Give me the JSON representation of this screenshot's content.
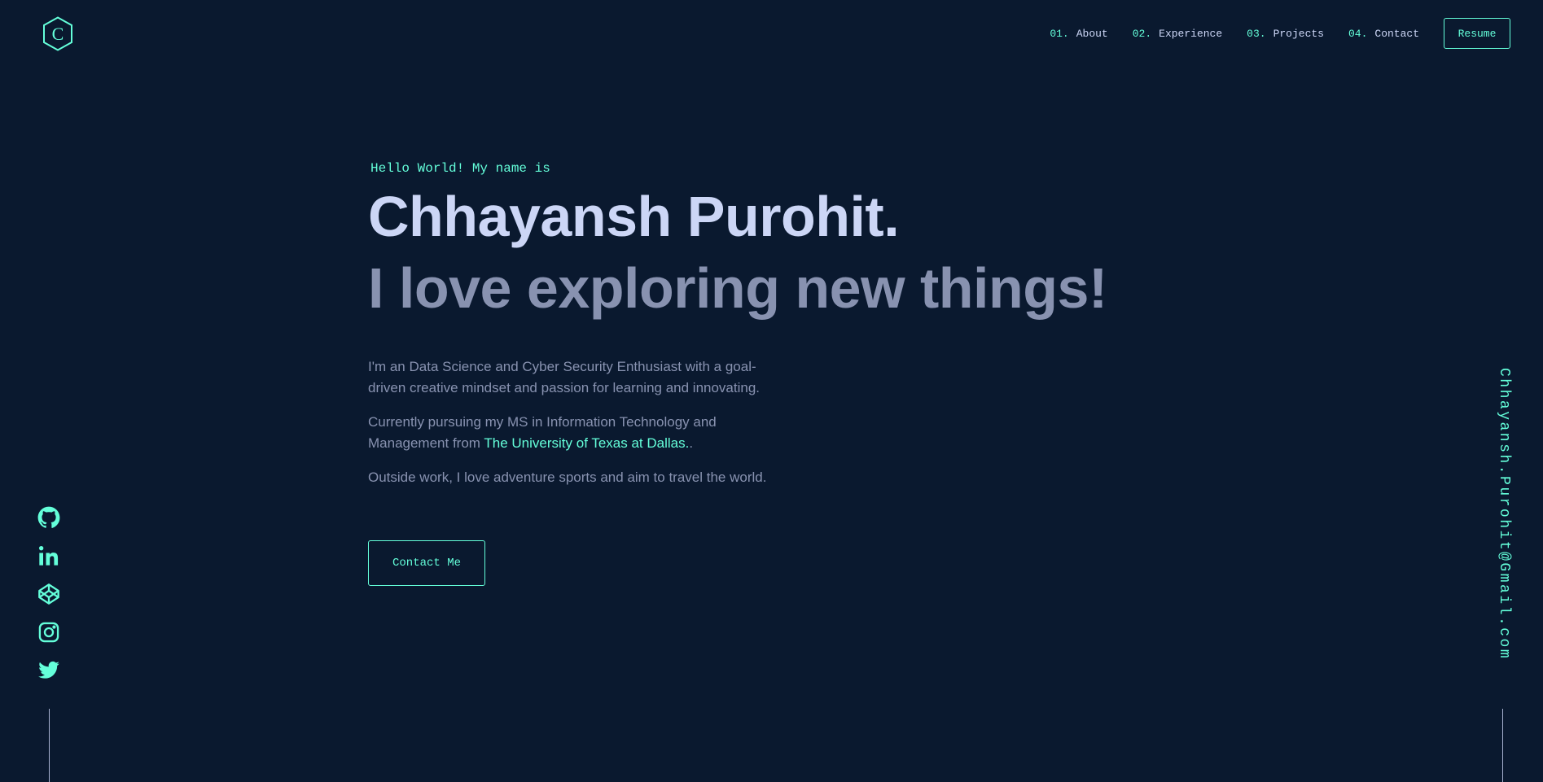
{
  "header": {
    "logo_letter": "C",
    "nav": [
      {
        "num": "01.",
        "label": "About"
      },
      {
        "num": "02.",
        "label": "Experience"
      },
      {
        "num": "03.",
        "label": "Projects"
      },
      {
        "num": "04.",
        "label": "Contact"
      }
    ],
    "resume_label": "Resume"
  },
  "hero": {
    "greeting": "Hello World! My name is",
    "name": "Chhayansh Purohit.",
    "tagline": "I love exploring new things!",
    "bio": {
      "p1": "I'm an Data Science and Cyber Security Enthusiast with a goal-driven creative mindset and passion for learning and innovating.",
      "p2_before": "Currently pursuing my MS in Information Technology and Management from ",
      "p2_link": "The University of Texas at Dallas.",
      "p2_after": ".",
      "p3": "Outside work, I love adventure sports and aim to travel the world."
    },
    "contact_label": "Contact Me"
  },
  "social": [
    "github-icon",
    "linkedin-icon",
    "codepen-icon",
    "instagram-icon",
    "twitter-icon"
  ],
  "email": "Chhayansh.Purohit@Gmail.com",
  "colors": {
    "background": "#0a192f",
    "accent": "#64ffda",
    "heading": "#ccd6f6",
    "text": "#8892b0"
  }
}
